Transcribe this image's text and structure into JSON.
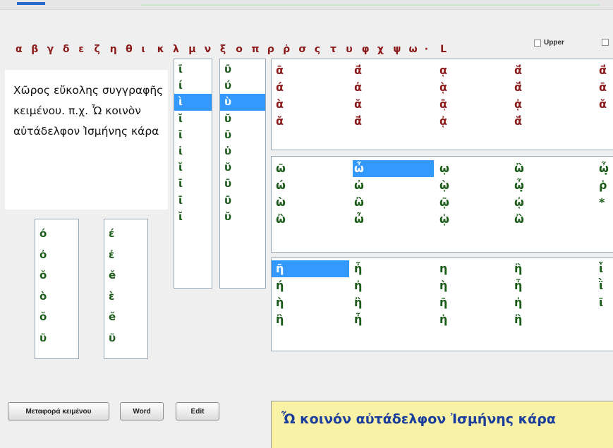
{
  "alphabet": [
    "α",
    "β",
    "γ",
    "δ",
    "ε",
    "ζ",
    "η",
    "θ",
    "ι",
    "κ",
    "λ",
    "μ",
    "ν",
    "ξ",
    "ο",
    "π",
    "ρ",
    "ῥ",
    "σ",
    "ς",
    "τ",
    "υ",
    "φ",
    "χ",
    "ψ",
    "ω",
    "·",
    "L"
  ],
  "upper_checkbox": {
    "label": "Upper",
    "checked": false
  },
  "second_checkbox": {
    "label": "",
    "checked": false
  },
  "editor_text": "Χῶρος εὔκολης συγγραφῆς κειμένου. π.χ. Ὦ κοινὸν αὐτάδελφον Ἰσμήνης κάρα",
  "list_omicron": [
    "ό",
    "ὀ",
    "ŏ",
    "ὸ",
    "ŏ",
    "ῦ"
  ],
  "list_epsilon": [
    "έ",
    "ἐ",
    "ĕ",
    "ὲ",
    "ĕ",
    "ῦ"
  ],
  "list_iota": [
    "ῑ",
    "ί",
    "ὶ",
    "ῐ",
    "ῑ",
    "ἰ",
    "ῐ",
    "ῑ",
    "ῑ",
    "ῐ"
  ],
  "list_iota_selected": 2,
  "list_upsilon": [
    "ῡ",
    "ύ",
    "ὺ",
    "ῠ",
    "ῡ",
    "ὑ",
    "ῠ",
    "ῡ",
    "ῡ",
    "ῠ"
  ],
  "list_upsilon_selected": 2,
  "alpha_grid": [
    [
      "ᾱ",
      "ᾱ̓",
      "ᾳ",
      "ᾰ̓",
      "ᾱ̓"
    ],
    [
      "ά",
      "ἀ",
      "ᾲ",
      "ᾰ̔",
      "ᾱ"
    ],
    [
      "ὰ",
      "ᾰ",
      "ᾱͅ",
      "ᾀ",
      "ᾰ"
    ],
    [
      "ᾰ",
      "ᾱ̓",
      "ᾀ",
      "ᾰ̓",
      ""
    ]
  ],
  "omega_grid": [
    [
      "ῶ",
      "ὦ",
      "ῳ",
      "ὢ",
      "ὦ̣"
    ],
    [
      "ώ",
      "ὠ",
      "ῲ",
      "ὦ̣",
      "ῥ"
    ],
    [
      "ὼ",
      "ὢ",
      "ῷ",
      "ᾠ",
      "*"
    ],
    [
      "ὢ",
      "ὦ",
      "ᾡ",
      "ὢ",
      ""
    ]
  ],
  "omega_selected": [
    0,
    1
  ],
  "eta_grid": [
    [
      "η̄",
      "ἦ",
      "η",
      "ἢ",
      "ἶ"
    ],
    [
      "ή",
      "ἠ",
      "ὴ",
      "ἦ",
      "ῒ"
    ],
    [
      "ὴ",
      "ἢ",
      "ῆ",
      "ἠ",
      "ῖ"
    ],
    [
      "ἢ",
      "ἦ",
      "ἡ",
      "ἢ",
      ""
    ]
  ],
  "eta_selected": [
    0,
    0
  ],
  "buttons": {
    "transfer": "Μεταφορά κειμένου",
    "word": "Word",
    "edit": "Edit"
  },
  "output_text": "Ὦ κοινόν αὐτάδελφον Ἰσμήνης κάρα"
}
